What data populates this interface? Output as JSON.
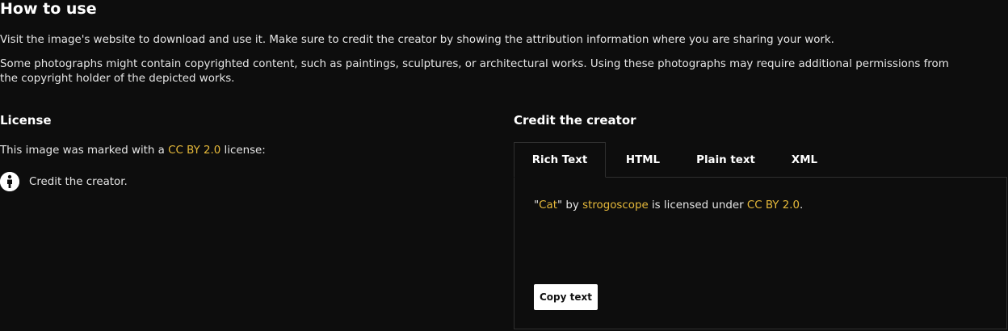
{
  "how_to_use": {
    "title": "How to use",
    "paragraph_1": "Visit the image's website to download and use it. Make sure to credit the creator by showing the attribution information where you are sharing your work.",
    "paragraph_2": "Some photographs might contain copyrighted content, such as paintings, sculptures, or architectural works. Using these photographs may require additional permissions from the copyright holder of the depicted works."
  },
  "license": {
    "title": "License",
    "desc_prefix": "This image was marked with a ",
    "license_link": "CC BY 2.0",
    "desc_suffix": " license:",
    "conditions": [
      {
        "icon": "cc-by-icon",
        "label": "Credit the creator."
      }
    ]
  },
  "credit": {
    "title": "Credit the creator",
    "tabs": [
      {
        "label": "Rich Text",
        "active": true
      },
      {
        "label": "HTML",
        "active": false
      },
      {
        "label": "Plain text",
        "active": false
      },
      {
        "label": "XML",
        "active": false
      }
    ],
    "attribution": {
      "open_quote": "\"",
      "work_title": "Cat",
      "by_text": "\" by ",
      "creator": "strogoscope",
      "licensed_text": " is licensed under ",
      "license": "CC BY 2.0",
      "end": "."
    },
    "copy_button": "Copy text"
  },
  "colors": {
    "background": "#0d0d0d",
    "text": "#ffffff",
    "link": "#e6b93a",
    "border": "#2f2f2f"
  }
}
